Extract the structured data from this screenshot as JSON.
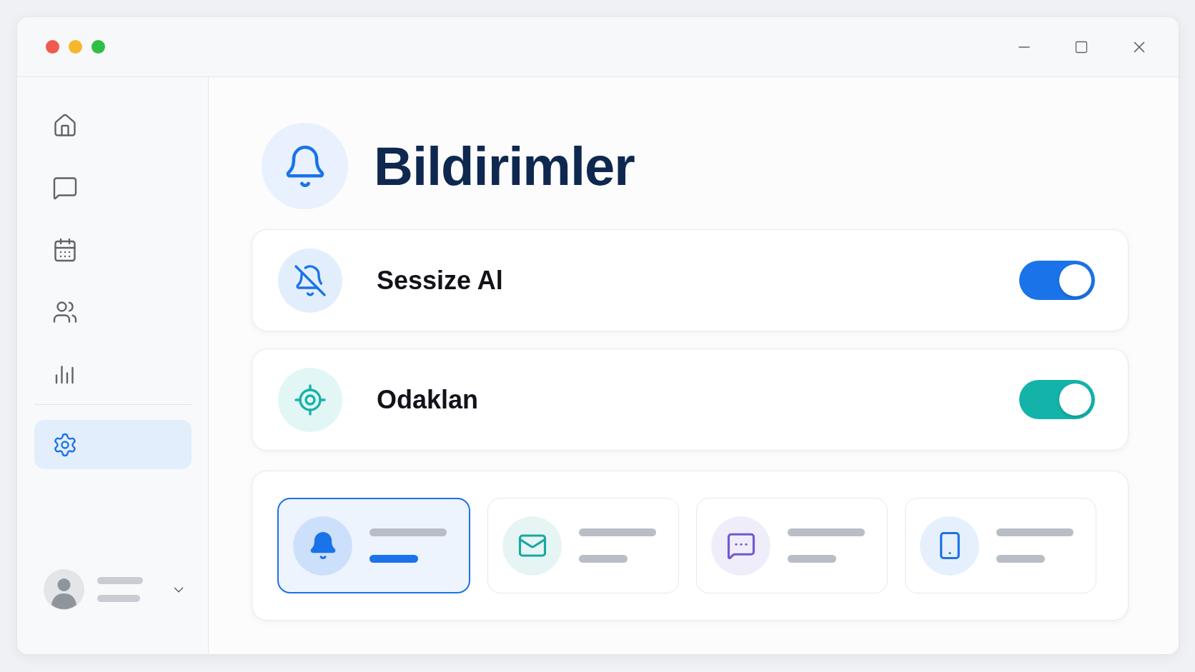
{
  "sidebar": {
    "items": [
      {
        "kind": "home",
        "selected": false
      },
      {
        "kind": "chat",
        "selected": false
      },
      {
        "kind": "calendar",
        "selected": false
      },
      {
        "kind": "people",
        "selected": false
      },
      {
        "kind": "chart",
        "selected": false
      },
      {
        "kind": "settings",
        "selected": true
      }
    ]
  },
  "header": {
    "title": "Bildirimler"
  },
  "settings": [
    {
      "kind": "mute",
      "label": "Sessize Al",
      "on": true,
      "color": "#1a73e8"
    },
    {
      "kind": "focus",
      "label": "Odaklan",
      "on": true,
      "color": "#14b3aa"
    }
  ],
  "option_tiles": [
    {
      "kind": "bell",
      "selected": true,
      "color": "#1a73e8"
    },
    {
      "kind": "mail",
      "selected": false,
      "color": "#17a89f"
    },
    {
      "kind": "chat",
      "selected": false,
      "color": "#7457d0"
    },
    {
      "kind": "phone",
      "selected": false,
      "color": "#1a73e8"
    }
  ]
}
